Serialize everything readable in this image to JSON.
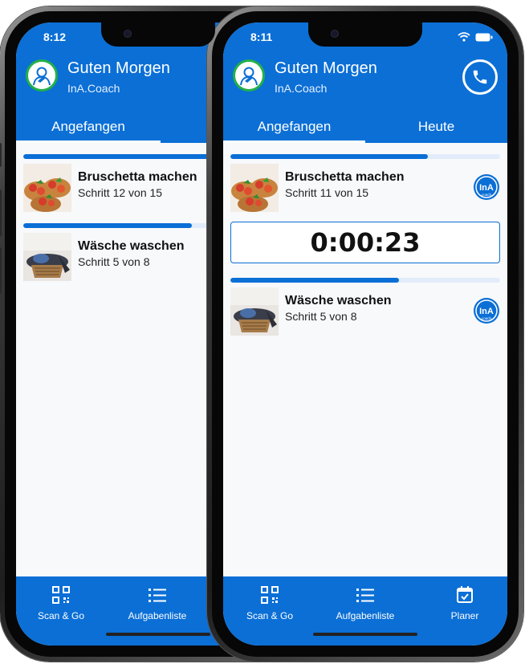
{
  "phones": [
    {
      "status": {
        "time": "8:12"
      },
      "header": {
        "greeting": "Guten Morgen",
        "subtitle": "InA.Coach"
      },
      "tabs": [
        {
          "label": "Angefangen",
          "active": true
        }
      ],
      "tasks": [
        {
          "title": "Bruschetta machen",
          "step": "Schritt 12 von 15",
          "progress": 0.8
        },
        {
          "title": "Wäsche waschen",
          "step": "Schritt 5 von 8",
          "progress": 0.625
        }
      ],
      "nav": [
        {
          "label": "Scan & Go",
          "icon": "qr-code-icon"
        },
        {
          "label": "Aufgabenliste",
          "icon": "list-icon"
        }
      ]
    },
    {
      "status": {
        "time": "8:11"
      },
      "header": {
        "greeting": "Guten Morgen",
        "subtitle": "InA.Coach"
      },
      "tabs": [
        {
          "label": "Angefangen",
          "active": true
        },
        {
          "label": "Heute",
          "active": false
        }
      ],
      "tasks": [
        {
          "title": "Bruschetta machen",
          "step": "Schritt 11 von 15",
          "progress": 0.733,
          "badge": "InA coach"
        },
        {
          "title": "Wäsche waschen",
          "step": "Schritt 5 von 8",
          "progress": 0.625,
          "badge": "InA coach"
        }
      ],
      "timer": "0:00:23",
      "nav": [
        {
          "label": "Scan & Go",
          "icon": "qr-code-icon"
        },
        {
          "label": "Aufgabenliste",
          "icon": "list-icon"
        },
        {
          "label": "Planer",
          "icon": "calendar-check-icon"
        }
      ]
    }
  ],
  "colors": {
    "primary": "#0b6fd6",
    "avatar_ring": "#22b04a",
    "progress_track": "#e2ecfa"
  }
}
